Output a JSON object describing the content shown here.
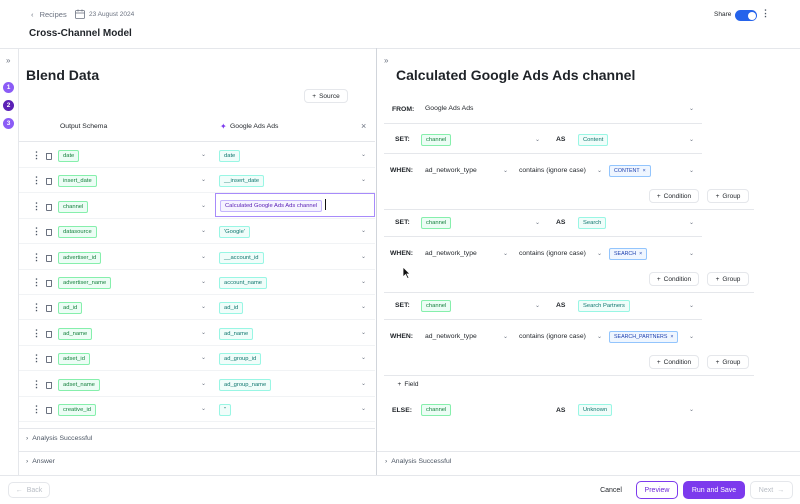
{
  "header": {
    "back_label": "Recipes",
    "date": "23 August 2024",
    "title": "Cross-Channel Model",
    "share_label": "Share"
  },
  "steps": [
    "1",
    "2",
    "3"
  ],
  "left": {
    "title": "Blend Data",
    "source_button": "Source",
    "col_schema": "Output Schema",
    "col_source": "Google Ads Ads",
    "rows": [
      {
        "field": "date",
        "value": "date"
      },
      {
        "field": "insert_date",
        "value": "__insert_date"
      },
      {
        "field": "channel",
        "value": "Calculated Google Ads Ads channel"
      },
      {
        "field": "datasource",
        "value": "'Google'"
      },
      {
        "field": "advertiser_id",
        "value": "__account_id"
      },
      {
        "field": "advertiser_name",
        "value": "account_name"
      },
      {
        "field": "ad_id",
        "value": "ad_id"
      },
      {
        "field": "ad_name",
        "value": "ad_name"
      },
      {
        "field": "adset_id",
        "value": "ad_group_id"
      },
      {
        "field": "adset_name",
        "value": "ad_group_name"
      },
      {
        "field": "creative_id",
        "value": "''"
      }
    ],
    "analysis_label": "Analysis Successful",
    "answer_label": "Answer"
  },
  "right": {
    "title": "Calculated Google Ads Ads channel",
    "from_kw": "FROM:",
    "from_value": "Google Ads Ads",
    "set_kw": "SET:",
    "when_kw": "WHEN:",
    "else_kw": "ELSE:",
    "as_kw": "AS",
    "blocks": [
      {
        "set_field": "channel",
        "as_value": "Content",
        "when_field": "ad_network_type",
        "operator": "contains (ignore case)",
        "match": "CONTENT"
      },
      {
        "set_field": "channel",
        "as_value": "Search",
        "when_field": "ad_network_type",
        "operator": "contains (ignore case)",
        "match": "SEARCH"
      },
      {
        "set_field": "channel",
        "as_value": "Search Partners",
        "when_field": "ad_network_type",
        "operator": "contains (ignore case)",
        "match": "SEARCH_PARTNERS"
      }
    ],
    "condition_button": "Condition",
    "group_button": "Group",
    "field_button": "Field",
    "else_field": "channel",
    "else_value": "Unknown",
    "analysis_label": "Analysis Successful"
  },
  "footer": {
    "back": "Back",
    "cancel": "Cancel",
    "preview": "Preview",
    "run_save": "Run and Save",
    "next": "Next"
  },
  "colors": {
    "accent": "#7c3aed",
    "toggle": "#2563eb",
    "step_done": "#7c3aed",
    "step_active": "#5b21b6"
  }
}
